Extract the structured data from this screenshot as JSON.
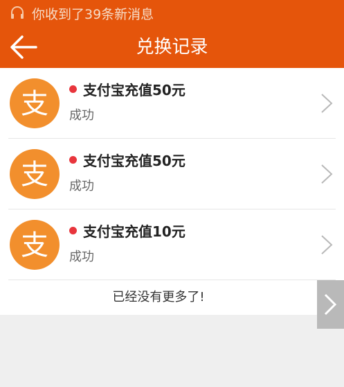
{
  "status_bar": {
    "notice": "你收到了39条新消息",
    "icon": "headset-icon"
  },
  "header": {
    "title": "兑换记录",
    "back_icon": "back-arrow-icon"
  },
  "records": [
    {
      "name": "支付宝充值50元",
      "status": "成功",
      "logo_text": "支"
    },
    {
      "name": "支付宝充值50元",
      "status": "成功",
      "logo_text": "支"
    },
    {
      "name": "支付宝充值10元",
      "status": "成功",
      "logo_text": "支"
    }
  ],
  "footer": {
    "end_text": "已经没有更多了!"
  },
  "colors": {
    "brand": "#e5550b",
    "avatar": "#f28f2d",
    "unread_dot": "#e8353c"
  }
}
